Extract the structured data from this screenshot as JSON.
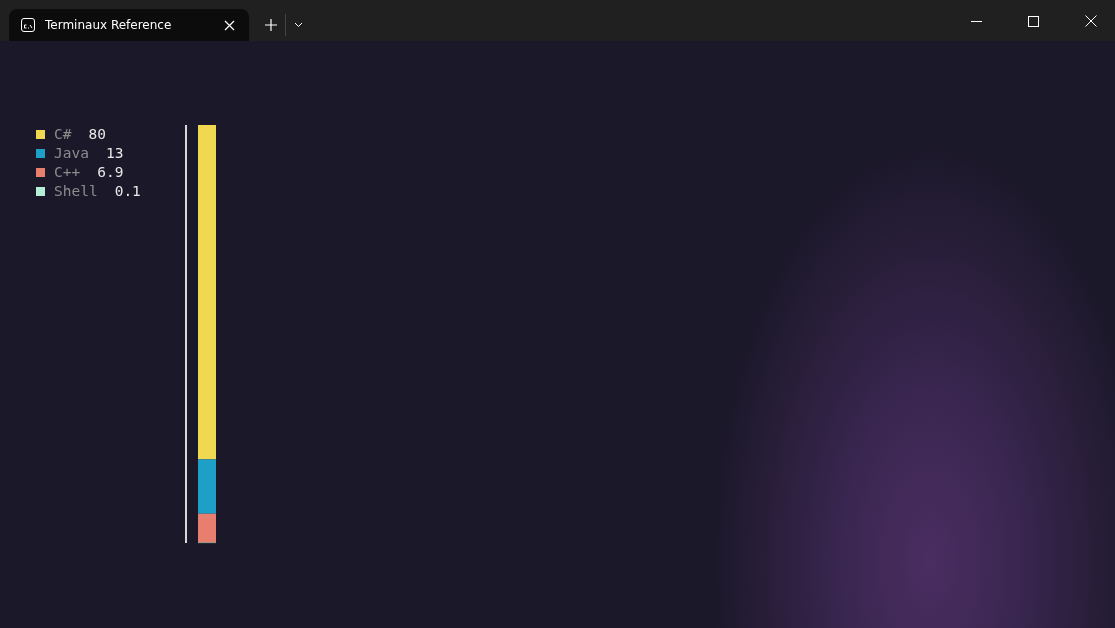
{
  "window": {
    "tab_title": "Terminaux Reference"
  },
  "languages": [
    {
      "name": "C#",
      "value": "80",
      "color": "#f0d850",
      "level": 0.8
    },
    {
      "name": "Java",
      "value": "13",
      "color": "#1e9fc8",
      "level": 0.13
    },
    {
      "name": "C++",
      "value": "6.9",
      "color": "#e87e6e",
      "level": 0.069
    },
    {
      "name": "Shell",
      "value": "0.1",
      "color": "#b4f0d8",
      "level": 0.001
    }
  ]
}
